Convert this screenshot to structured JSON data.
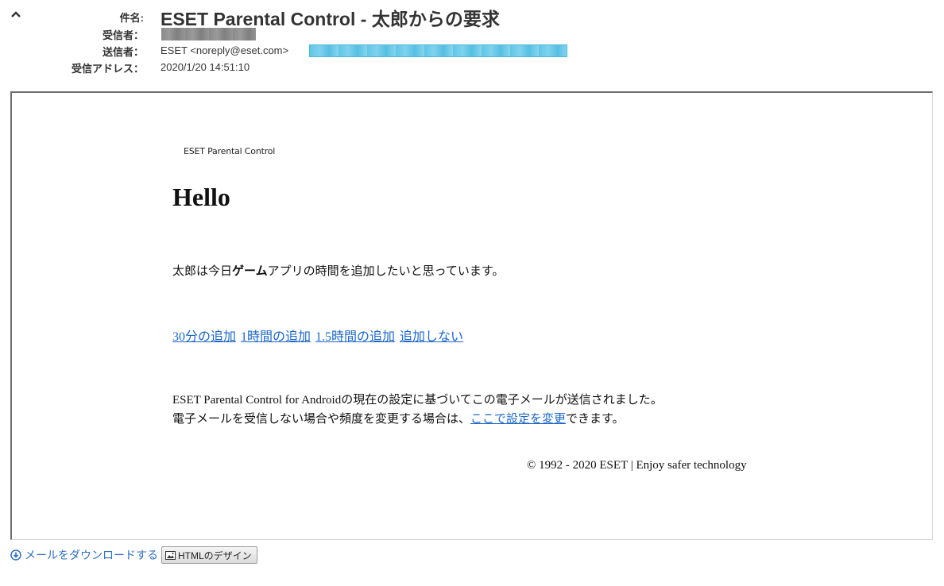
{
  "header": {
    "subject_label": "件名:",
    "subject": "ESET Parental Control - 太郎からの要求",
    "to_label": "受信者：",
    "from_label": "送信者：",
    "from_value": "ESET <noreply@eset.com>",
    "date_label": "受信アドレス：",
    "date_value": "2020/1/20 14:51:10",
    "collapse_icon": "chevron-up-icon"
  },
  "mail": {
    "brand": "ESET Parental Control",
    "greeting": "Hello",
    "request": {
      "prefix": "太郎は今日",
      "category": "ゲーム",
      "suffix": "アプリの時間を追加したいと思っています。"
    },
    "actions": [
      "30分の追加",
      "1時間の追加",
      "1.5時間の追加",
      "追加しない"
    ],
    "notice": {
      "line1": "ESET Parental Control for Androidの現在の設定に基づいてこの電子メールが送信されました。",
      "line2_prefix": "電子メールを受信しない場合や頻度を変更する場合は、",
      "line2_link": "ここで設定を変更",
      "line2_suffix": "できます。"
    },
    "footer": "© 1992 - 2020 ESET | Enjoy safer technology"
  },
  "bottom": {
    "download_label": "メールをダウンロードする",
    "download_icon": "download-circle-icon",
    "html_design_label": "HTMLのデザイン",
    "html_design_icon": "image-icon"
  },
  "colors": {
    "link": "#1a66c9",
    "redaction_to": "#8a8a8a",
    "redaction_from": "#5fc6e6"
  }
}
